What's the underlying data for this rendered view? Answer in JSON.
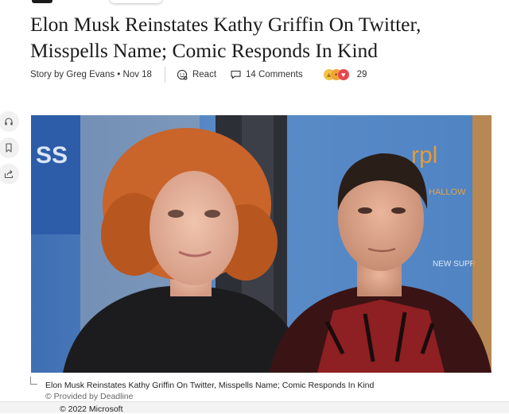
{
  "article": {
    "headline": "Elon Musk Reinstates Kathy Griffin On Twitter, Misspells Name; Comic Responds In Kind",
    "byline": "Story by Greg Evans • Nov 18",
    "react_label": "React",
    "comments_label": "14 Comments",
    "reaction_count": "29"
  },
  "image": {
    "caption": "Elon Musk Reinstates Kathy Griffin On Twitter, Misspells Name; Comic Responds In Kind",
    "credit": "© Provided by Deadline"
  },
  "footer": {
    "copyright": "© 2022 Microsoft"
  },
  "side_actions": [
    {
      "icon": "headphones-icon"
    },
    {
      "icon": "bookmark-icon"
    },
    {
      "icon": "share-icon"
    }
  ],
  "colors": {
    "backdrop_blue": "#4a7fbe",
    "hair_orange": "#c9642b",
    "jacket_red": "#8e1f22"
  }
}
